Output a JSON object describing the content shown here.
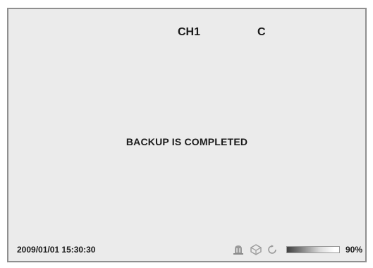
{
  "header": {
    "channel": "CH1",
    "mode": "C"
  },
  "message": "BACKUP IS COMPLETED",
  "status_bar": {
    "datetime": "2009/01/01 15:30:30",
    "icons": [
      "alarm-icon",
      "network-icon",
      "refresh-icon"
    ],
    "capacity_percent": 90,
    "capacity_label": "90%"
  },
  "colors": {
    "background": "#ebebeb",
    "text": "#1a1a1a",
    "border": "#8f8f8f"
  }
}
